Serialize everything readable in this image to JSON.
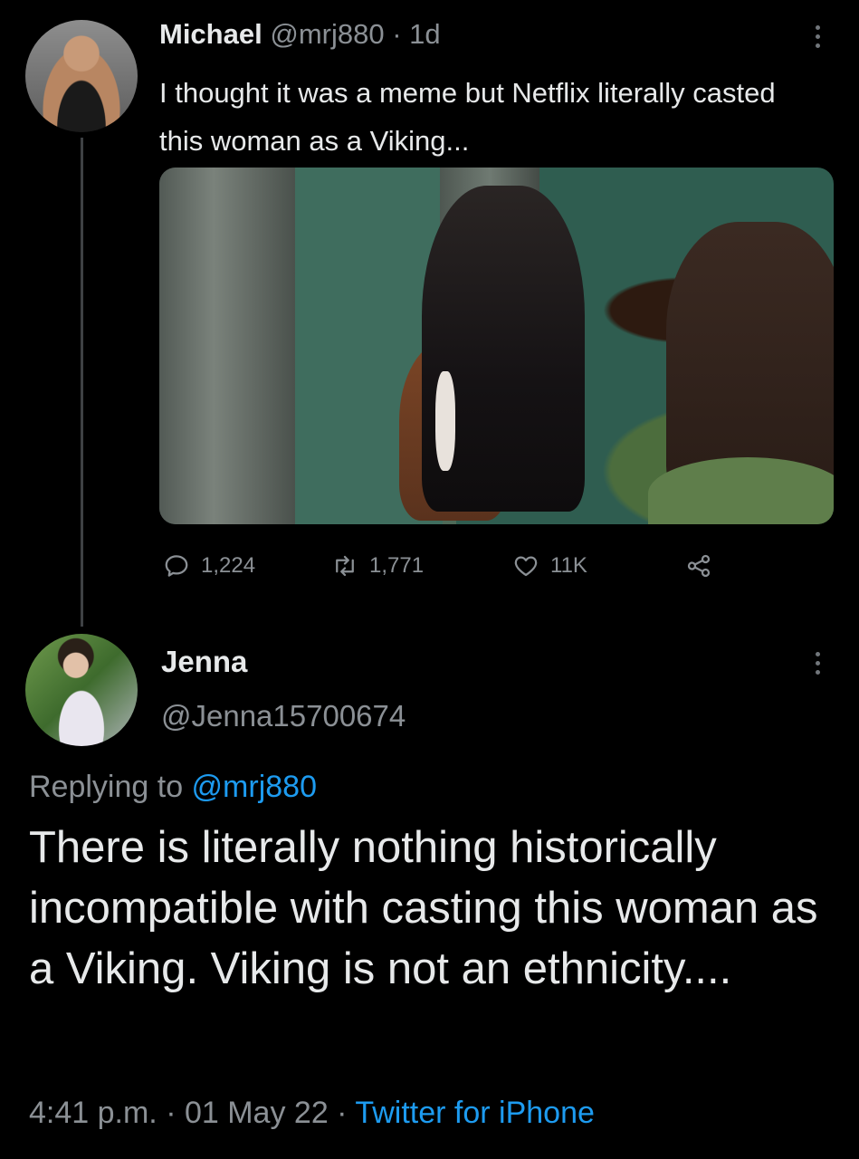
{
  "tweet1": {
    "author_name": "Michael",
    "handle": "@mrj880",
    "separator": " · ",
    "age": "1d",
    "text": "I thought it was a meme but Netflix literally casted this woman as a Viking...",
    "replies": "1,224",
    "retweets": "1,771",
    "likes": "11K"
  },
  "tweet2": {
    "author_name": "Jenna",
    "handle": "@Jenna15700674",
    "replying_prefix": "Replying to ",
    "replying_to": "@mrj880",
    "text": "There is literally nothing historically incompatible with casting this woman as a Viking. Viking is not an ethnicity....",
    "time": "4:41 p.m.",
    "sep1": " · ",
    "date": "01 May 22",
    "sep2": " · ",
    "source": "Twitter for iPhone"
  },
  "icons": {
    "reply": "reply-icon",
    "retweet": "retweet-icon",
    "like": "heart-icon",
    "share": "share-icon",
    "more": "more-icon"
  },
  "colors": {
    "background": "#000000",
    "text": "#e7e9ea",
    "muted": "#8b9095",
    "link": "#1d9bf0"
  }
}
